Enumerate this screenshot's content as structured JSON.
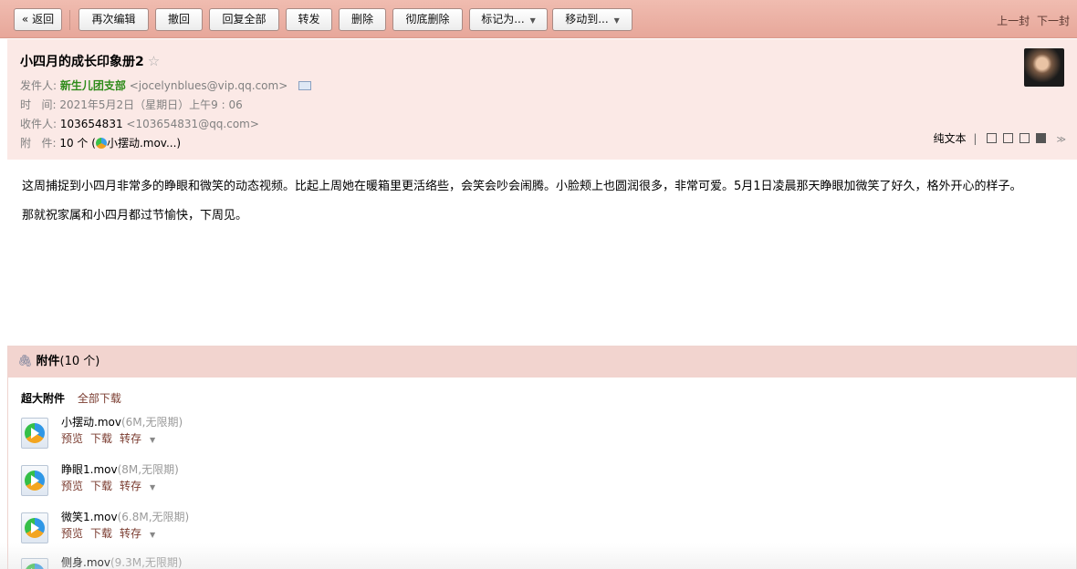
{
  "toolbar": {
    "back": "« 返回",
    "buttons": [
      "再次编辑",
      "撤回",
      "回复全部",
      "转发",
      "删除",
      "彻底删除"
    ],
    "mark_as": "标记为...",
    "move_to": "移动到...",
    "prev": "上一封",
    "next": "下一封"
  },
  "mail": {
    "subject": "小四月的成长印象册2",
    "star": "☆",
    "from_label": "发件人:",
    "from_name": "新生儿团支部",
    "from_email": "<jocelynblues@vip.qq.com>",
    "time_label": "时   间:",
    "time_value": "2021年5月2日（星期日）上午9 : 06",
    "to_label": "收件人:",
    "to_name": "103654831",
    "to_email": "<103654831@qq.com>",
    "att_label": "附   件:",
    "att_count": "10 个",
    "att_open": "(",
    "att_first": "小摆动.mov...",
    "att_close": ")",
    "plain_text": "纯文本"
  },
  "body": {
    "p1": "这周捕捉到小四月非常多的睁眼和微笑的动态视频。比起上周她在暖箱里更活络些，会笑会吵会闹腾。小脸颊上也圆润很多，非常可爱。5月1日凌晨那天睁眼加微笑了好久，格外开心的样子。",
    "p2": "那就祝家属和小四月都过节愉快，下周见。"
  },
  "attachments": {
    "title": "附件",
    "count": "(10 个)",
    "section": "超大附件",
    "download_all": "全部下载",
    "actions": {
      "preview": "预览",
      "download": "下载",
      "save": "转存"
    },
    "files": [
      {
        "name": "小摆动.mov",
        "meta": "(6M,无限期)"
      },
      {
        "name": "睁眼1.mov",
        "meta": "(8M,无限期)"
      },
      {
        "name": "微笑1.mov",
        "meta": "(6.8M,无限期)"
      },
      {
        "name": "侧身.mov",
        "meta": "(9.3M,无限期)"
      }
    ]
  }
}
